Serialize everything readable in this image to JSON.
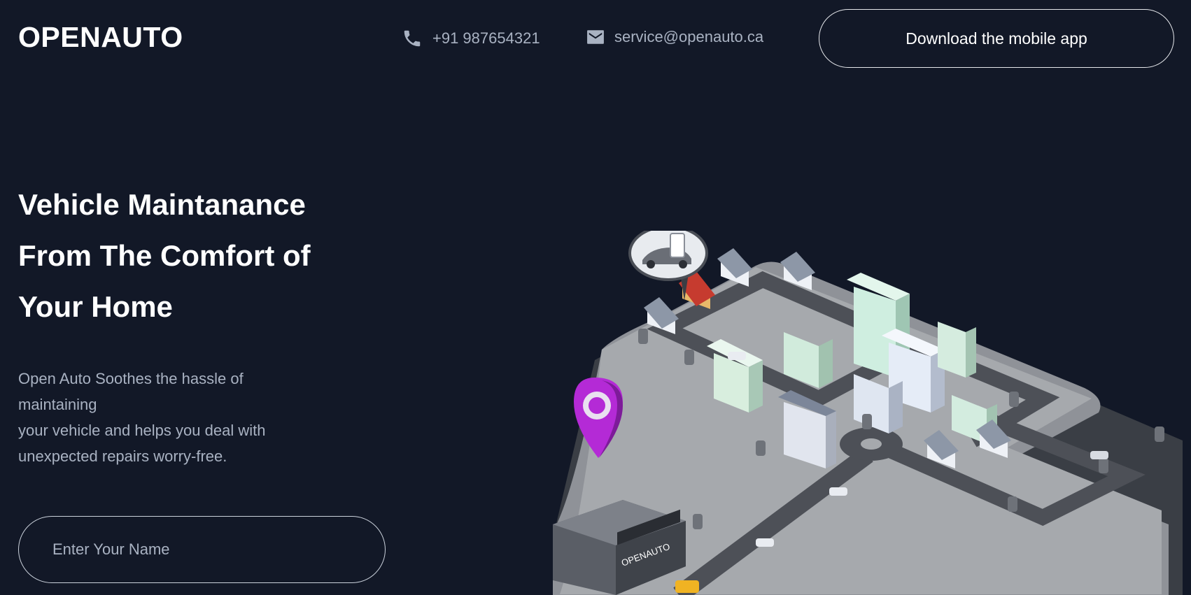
{
  "header": {
    "logo": "OPENAUTO",
    "phone": "+91 987654321",
    "phone_icon": "phone-icon",
    "email": "service@openauto.ca",
    "email_icon": "mail-icon",
    "download_button": "Download the mobile app"
  },
  "hero": {
    "title_lines": [
      "Vehicle Maintanance",
      "From The Comfort of",
      "Your Home"
    ],
    "description_lines": [
      "Open Auto Soothes the hassle of",
      "maintaining",
      "your vehicle and helps you deal with",
      "unexpected repairs worry-free."
    ],
    "name_input": {
      "value": "",
      "placeholder": "Enter Your Name"
    }
  },
  "illustration": {
    "shop_sign": "OPENAUTO",
    "pin_icon": "location-pin-icon"
  },
  "colors": {
    "background": "#121827",
    "text_primary": "#ffffff",
    "text_muted": "#a9b2c2",
    "pin_accent": "#b42ad6"
  }
}
